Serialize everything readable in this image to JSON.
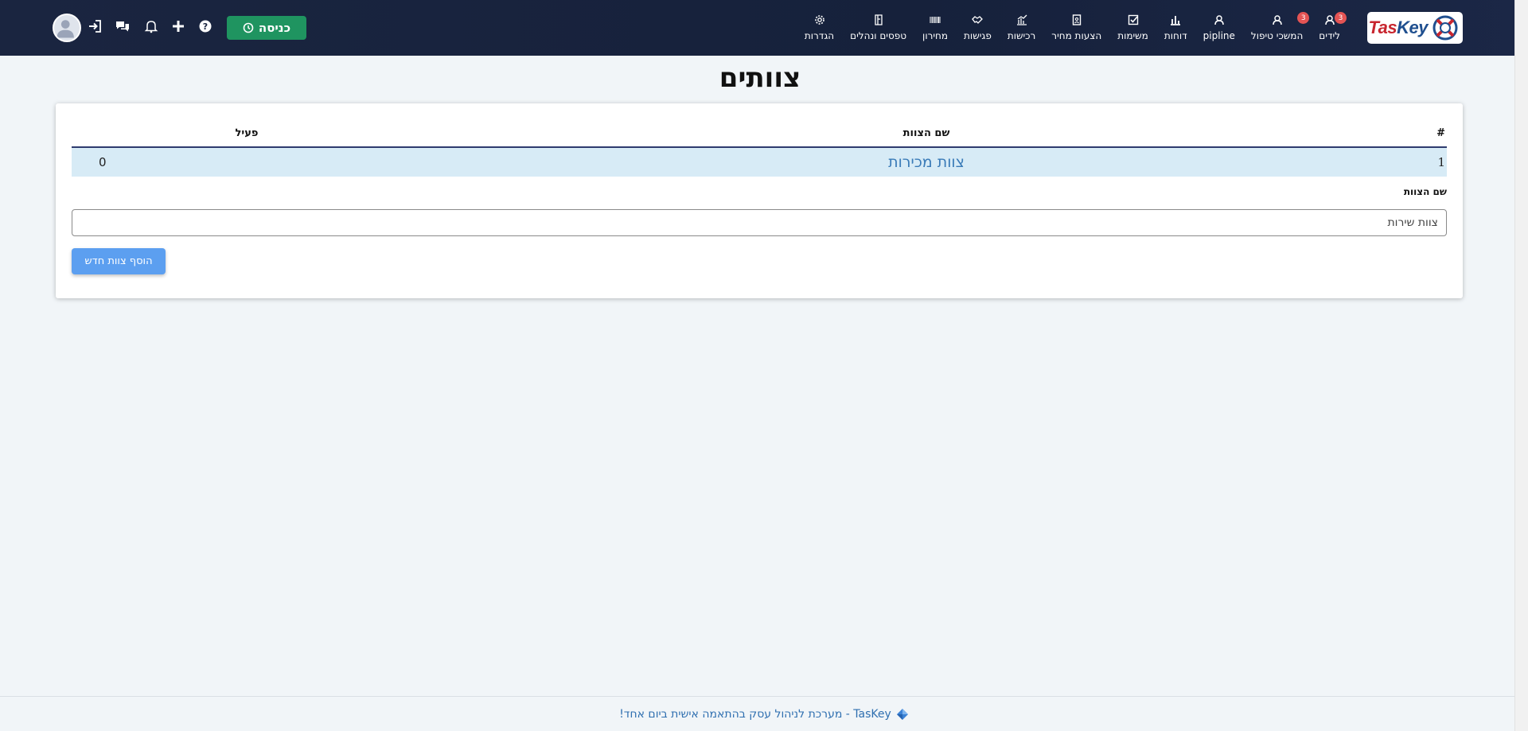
{
  "header": {
    "logo_text_a": "Tas",
    "logo_text_b": "Key",
    "nav": [
      {
        "label": "לידים",
        "icon": "user-icon",
        "badge": "3"
      },
      {
        "label": "המשכי טיפול",
        "icon": "user-icon",
        "badge": "3"
      },
      {
        "label": "pipline",
        "icon": "user-icon",
        "badge": ""
      },
      {
        "label": "דוחות",
        "icon": "bar-chart-icon",
        "badge": ""
      },
      {
        "label": "משימות",
        "icon": "checkbox-icon",
        "badge": ""
      },
      {
        "label": "הצעות מחיר",
        "icon": "document-icon",
        "badge": ""
      },
      {
        "label": "רכישות",
        "icon": "purchase-chart-icon",
        "badge": ""
      },
      {
        "label": "פגישות",
        "icon": "handshake-icon",
        "badge": ""
      },
      {
        "label": "מחירון",
        "icon": "barcode-icon",
        "badge": ""
      },
      {
        "label": "טפסים ונהלים",
        "icon": "book-icon",
        "badge": ""
      },
      {
        "label": "הגדרות",
        "icon": "gear-icon",
        "badge": ""
      }
    ],
    "enter_label": "כניסה"
  },
  "page": {
    "title": "צוותים"
  },
  "table": {
    "headers": {
      "num": "#",
      "name": "שם הצוות",
      "active": "פעיל"
    },
    "rows": [
      {
        "num": "1",
        "name": "צוות מכירות",
        "active": "0"
      }
    ]
  },
  "form": {
    "label": "שם הצוות",
    "input_value": "צוות שירות",
    "add_button": "הוסף צוות חדש"
  },
  "footer": {
    "text": "TasKey - מערכת לניהול עסק בהתאמה אישית ביום אחד!"
  },
  "colors": {
    "navbar": "#1a2540",
    "enter_button": "#1f9460",
    "add_button": "#5c9ff0",
    "row_highlight": "#d7ebf6",
    "link": "#3a7bb8",
    "badge": "#e45454"
  }
}
